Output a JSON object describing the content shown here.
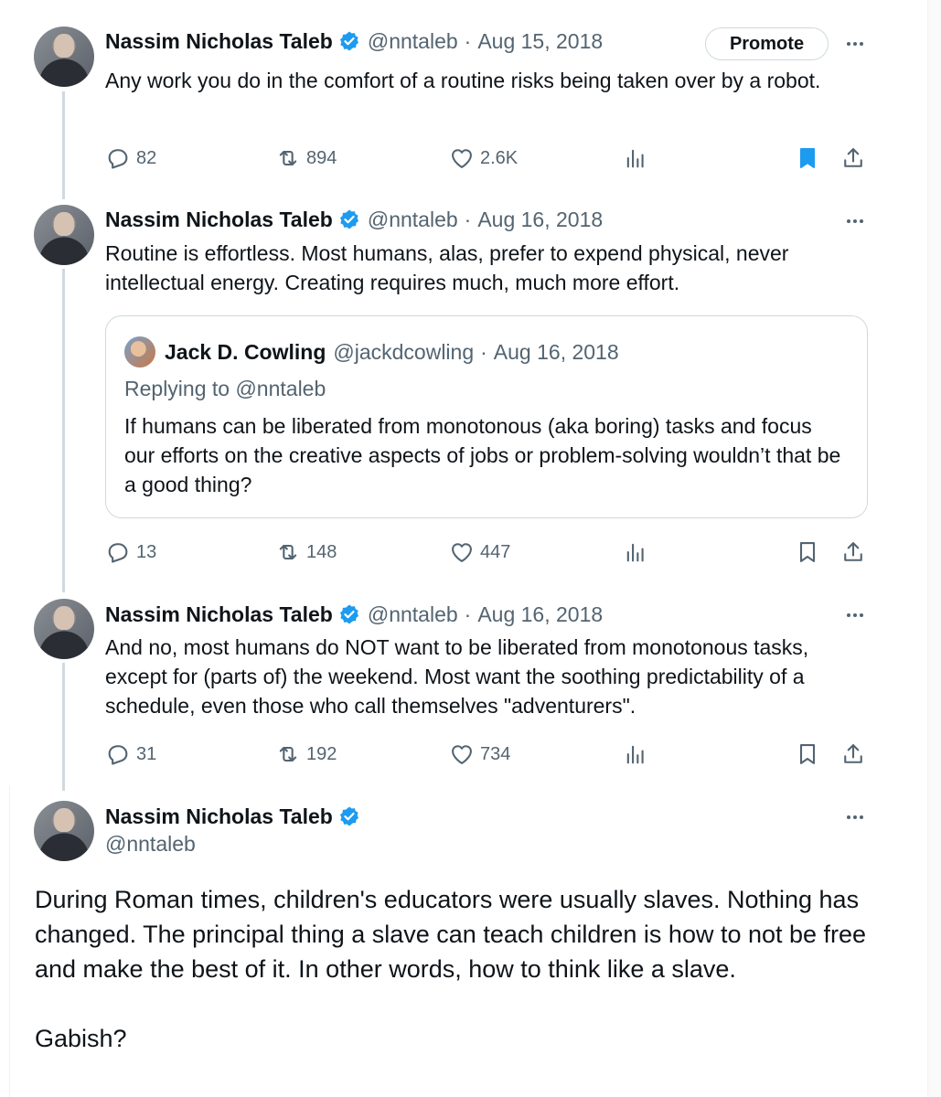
{
  "tweets": [
    {
      "name": "Nassim Nicholas Taleb",
      "handle": "@nntaleb",
      "date": "Aug 15, 2018",
      "promote_label": "Promote",
      "text": "Any work you do in the comfort of a routine risks being taken over by a robot.",
      "replies": "82",
      "retweets": "894",
      "likes": "2.6K",
      "bookmarked": true
    },
    {
      "name": "Nassim Nicholas Taleb",
      "handle": "@nntaleb",
      "date": "Aug 16, 2018",
      "text": "Routine is effortless. Most humans, alas, prefer to expend physical, never intellectual energy. Creating requires much, much more effort.",
      "quote": {
        "name": "Jack D. Cowling",
        "handle": "@jackdcowling",
        "date": "Aug 16, 2018",
        "replying_to": "Replying to @nntaleb",
        "text": "If humans can be liberated from monotonous (aka boring) tasks and focus our efforts on the creative aspects of jobs or problem-solving wouldn’t that be a good thing?"
      },
      "replies": "13",
      "retweets": "148",
      "likes": "447",
      "bookmarked": false
    },
    {
      "name": "Nassim Nicholas Taleb",
      "handle": "@nntaleb",
      "date": "Aug 16, 2018",
      "text": "And no, most humans do NOT want to be liberated from monotonous tasks, except for (parts of) the weekend. Most want the soothing predictability of a schedule, even those who call themselves \"adventurers\".",
      "replies": "31",
      "retweets": "192",
      "likes": "734",
      "bookmarked": false
    }
  ],
  "main_tweet": {
    "name": "Nassim Nicholas Taleb",
    "handle": "@nntaleb",
    "paragraph_1": "During Roman times, children's educators were usually slaves. Nothing has changed. The principal thing a slave can teach children is how to not be free and make the best of it. In other words, how to think like a slave.",
    "paragraph_2": "Gabish?"
  },
  "colors": {
    "accent": "#1d9bf0",
    "secondary_text": "#536471",
    "primary_text": "#0f1419",
    "border": "#cfd9de"
  },
  "icons": {
    "reply": "reply-icon",
    "retweet": "retweet-icon",
    "like": "heart-icon",
    "views": "views-icon",
    "bookmark": "bookmark-icon",
    "share": "share-icon",
    "verified": "verified-badge-icon",
    "more": "more-icon"
  }
}
